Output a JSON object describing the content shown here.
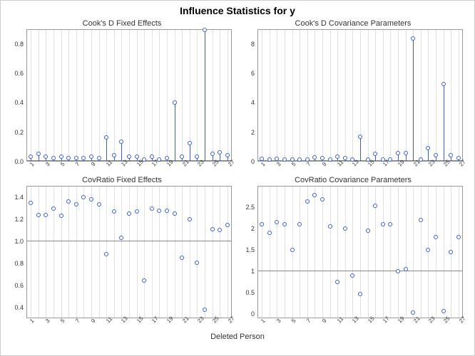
{
  "title": "Influence Statistics for y",
  "xlabel": "Deleted Person",
  "chart_data": [
    {
      "type": "bar",
      "title": "Cook's D Fixed Effects",
      "categories": [
        1,
        2,
        3,
        4,
        5,
        6,
        7,
        8,
        9,
        10,
        11,
        12,
        13,
        14,
        15,
        16,
        17,
        18,
        19,
        20,
        21,
        22,
        23,
        24,
        25,
        26,
        27
      ],
      "values": [
        0.03,
        0.05,
        0.03,
        0.02,
        0.03,
        0.02,
        0.02,
        0.02,
        0.03,
        0.02,
        0.16,
        0.04,
        0.13,
        0.03,
        0.03,
        0.01,
        0.03,
        0.01,
        0.02,
        0.4,
        0.03,
        0.12,
        0.03,
        0.9,
        0.05,
        0.06,
        0.04
      ],
      "ylim": [
        0,
        0.9
      ],
      "yticks": [
        0.0,
        0.2,
        0.4,
        0.6,
        0.8
      ],
      "refline": 0,
      "stems": true
    },
    {
      "type": "bar",
      "title": "Cook's D Covariance Parameters",
      "categories": [
        1,
        2,
        3,
        4,
        5,
        6,
        7,
        8,
        9,
        10,
        11,
        12,
        13,
        14,
        15,
        16,
        17,
        18,
        19,
        20,
        21,
        22,
        23,
        24,
        25,
        26,
        27
      ],
      "values": [
        0.15,
        0.1,
        0.15,
        0.1,
        0.08,
        0.08,
        0.1,
        0.25,
        0.2,
        0.1,
        0.3,
        0.2,
        0.1,
        1.65,
        0.1,
        0.5,
        0.1,
        0.1,
        0.55,
        0.55,
        8.4,
        0.1,
        0.9,
        0.4,
        5.3,
        0.4,
        0.2
      ],
      "ylim": [
        0,
        9
      ],
      "yticks": [
        0,
        2,
        4,
        6,
        8
      ],
      "refline": 0,
      "stems": true
    },
    {
      "type": "scatter",
      "title": "CovRatio Fixed Effects",
      "categories": [
        1,
        2,
        3,
        4,
        5,
        6,
        7,
        8,
        9,
        10,
        11,
        12,
        13,
        14,
        15,
        16,
        17,
        18,
        19,
        20,
        21,
        22,
        23,
        24,
        25,
        26,
        27
      ],
      "values": [
        1.35,
        1.24,
        1.24,
        1.3,
        1.23,
        1.36,
        1.34,
        1.4,
        1.38,
        1.34,
        0.88,
        1.27,
        1.03,
        1.25,
        1.27,
        0.64,
        1.3,
        1.28,
        1.28,
        1.25,
        0.85,
        1.2,
        0.8,
        0.37,
        1.11,
        1.1,
        1.15
      ],
      "ylim": [
        0.3,
        1.5
      ],
      "yticks": [
        0.4,
        0.6,
        0.8,
        1.0,
        1.2,
        1.4
      ],
      "refline": 1.0,
      "stems": false
    },
    {
      "type": "scatter",
      "title": "CovRatio Covariance Parameters",
      "categories": [
        1,
        2,
        3,
        4,
        5,
        6,
        7,
        8,
        9,
        10,
        11,
        12,
        13,
        14,
        15,
        16,
        17,
        18,
        19,
        20,
        21,
        22,
        23,
        24,
        25,
        26,
        27
      ],
      "values": [
        2.1,
        1.9,
        2.15,
        2.1,
        1.5,
        2.1,
        2.65,
        2.8,
        2.7,
        2.05,
        0.75,
        2.0,
        0.9,
        0.45,
        1.95,
        2.55,
        2.1,
        2.1,
        1.0,
        1.05,
        0.02,
        2.2,
        1.5,
        1.8,
        0.05,
        1.45,
        1.8
      ],
      "ylim": [
        -0.1,
        3.0
      ],
      "yticks": [
        0.0,
        0.5,
        1.0,
        1.5,
        2.0,
        2.5
      ],
      "refline": 1.0,
      "stems": false
    }
  ],
  "xtick_labels": [
    1,
    3,
    5,
    7,
    9,
    11,
    13,
    15,
    17,
    19,
    21,
    23,
    25,
    27
  ]
}
